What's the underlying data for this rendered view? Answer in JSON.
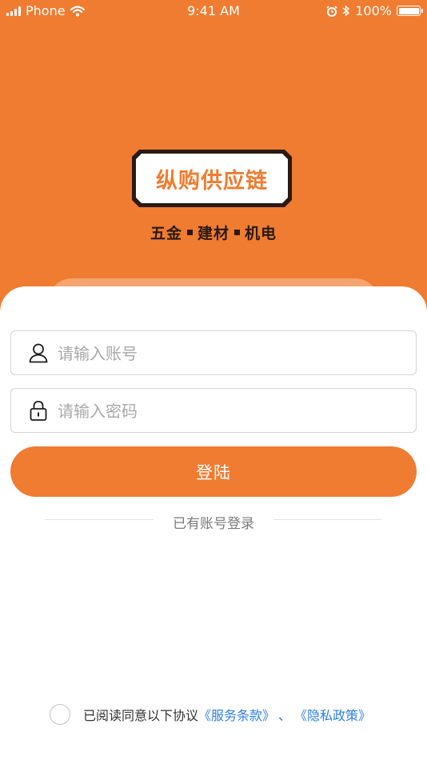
{
  "status_bar": {
    "carrier": "Phone",
    "time": "9:41 AM",
    "battery": "100%",
    "icons": [
      "signal-icon",
      "wifi-icon",
      "alarm-icon",
      "bluetooth-icon",
      "battery-icon"
    ]
  },
  "brand": {
    "logo_text": "纵购供应链",
    "tagline": [
      "五金",
      "建材",
      "机电"
    ]
  },
  "form": {
    "account_placeholder": "请输入账号",
    "password_placeholder": "请输入密码",
    "login_label": "登陆",
    "divider_text": "已有账号登录"
  },
  "agreement": {
    "text": "已阅读同意以下协议",
    "terms_link": "《服务条款》",
    "separator": "、",
    "privacy_link": "《隐私政策》"
  },
  "colors": {
    "brand": "#ef7c31",
    "link": "#2f7fe0"
  }
}
